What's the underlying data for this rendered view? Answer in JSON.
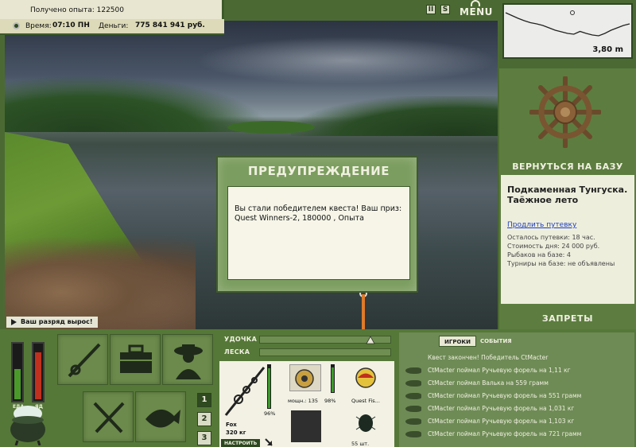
{
  "header": {
    "experience_label": "Получено опыта:",
    "experience_value": "122500",
    "time_label": "Время:",
    "time_value": "07:10 ПН",
    "money_label": "Деньги:",
    "money_value": "775 841 941 руб."
  },
  "top_controls": {
    "pause_label": "II",
    "sound_label": "S",
    "menu_label": "MENU"
  },
  "depth": {
    "value": "3,80 m",
    "profile": [
      0.08,
      0.15,
      0.22,
      0.28,
      0.33,
      0.36,
      0.4,
      0.46,
      0.52,
      0.56,
      0.6,
      0.62,
      0.55,
      0.6,
      0.64,
      0.66,
      0.6,
      0.52,
      0.46,
      0.4,
      0.36
    ]
  },
  "right_panel": {
    "return_button": "ВЕРНУТЬСЯ НА БАЗУ",
    "base_title_1": "Подкаменная Тунгуска.",
    "base_title_2": "Таёжное лето",
    "extend_link": "Продлить путевку",
    "remaining": "Осталось путевки: 18 час.",
    "cost": "Стоимость дня: 24 000 руб.",
    "fishers": "Рыбаков на базе: 4",
    "tournaments": "Турниры на базе: не объявлены",
    "bans_button": "ЗАПРЕТЫ"
  },
  "rank_notice": "Ваш разряд вырос!",
  "dialog": {
    "title": "ПРЕДУПРЕЖДЕНИЕ",
    "message_1": "Вы стали победителем квеста! Ваш приз:",
    "message_2": "Quest Winners-2, 180000 , Опыта"
  },
  "meters": {
    "food_label": "ЕДА",
    "poison_label": "ЯД",
    "food_level": 0.55,
    "poison_level": 0.85,
    "food_color": "#4a9a2a",
    "poison_color": "#c0301e"
  },
  "action_icons": [
    "rod-icon",
    "tackle-box-icon",
    "fisherman-icon",
    "fork-knife-icon",
    "fish-icon"
  ],
  "pages": [
    "1",
    "2",
    "3"
  ],
  "tackle": {
    "rod_label": "УДОЧКА",
    "line_label": "ЛЕСКА",
    "rod_name": "Fox",
    "rod_weight": "320 кг",
    "rod_percent": "96%",
    "rod_level": 0.96,
    "reel_power": "мощн.: 135",
    "reel_percent": "98%",
    "reel_level": 0.98,
    "lure_name": "Quest Fis...",
    "bait_amount": "55 шт.",
    "setup_button": "НАСТРОИТЬ"
  },
  "chat": {
    "tab_players": "ИГРОКИ",
    "tab_events": "СОБЫТИЯ",
    "messages": [
      "Квест закончен! Победитель CtMacter",
      "CtMacter поймал Ручьевую форель на 1,11 кг",
      "CtMacter поймал Валька на 559 грамм",
      "CtMacter поймал Ручьевую форель на 551 грамм",
      "CtMacter поймал Ручьевую форель на 1,031 кг",
      "CtMacter поймал Ручьевую форель на 1,103 кг",
      "CtMacter поймал Ручьевую форель на 721 грамм"
    ]
  }
}
